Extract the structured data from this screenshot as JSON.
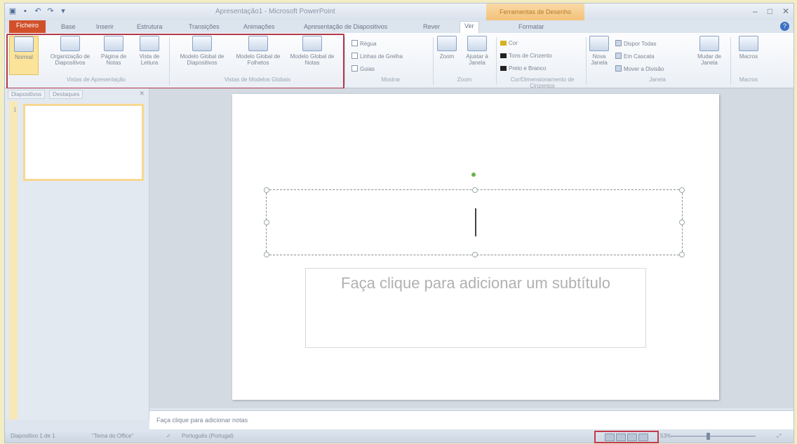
{
  "window": {
    "title": "Apresentação1 - Microsoft PowerPoint",
    "context_tab_title": "Ferramentas de Desenho"
  },
  "tabs": [
    {
      "label": "Ficheiro"
    },
    {
      "label": "Base"
    },
    {
      "label": "Inserir"
    },
    {
      "label": "Estrutura"
    },
    {
      "label": "Transições"
    },
    {
      "label": "Animações"
    },
    {
      "label": "Apresentação de Diapositivos"
    },
    {
      "label": "Rever"
    },
    {
      "label": "Ver"
    },
    {
      "label": "Formatar"
    }
  ],
  "ribbon": {
    "presentation_views": {
      "label": "Vistas de Apresentação",
      "buttons": [
        "Normal",
        "Organização de Diapositivos",
        "Página de Notas",
        "Vista de Leitura"
      ]
    },
    "master_views": {
      "label": "Vistas de Modelos Globais",
      "buttons": [
        "Modelo Global de Diapositivos",
        "Modelo Global de Folhetos",
        "Modelo Global de Notas"
      ]
    },
    "show": {
      "label": "Mostrar",
      "items": [
        "Régua",
        "Linhas de Grelha",
        "Guias"
      ]
    },
    "zoom": {
      "label": "Zoom",
      "buttons": [
        "Zoom",
        "Ajustar à Janela"
      ]
    },
    "color": {
      "label": "Cor/Dimensionamento de Cinzentos",
      "items": [
        "Cor",
        "Tons de Cinzento",
        "Preto e Branco"
      ]
    },
    "window": {
      "label": "Janela",
      "new_window": "Nova Janela",
      "items": [
        "Dispor Todas",
        "Em Cascata",
        "Mover a Divisão"
      ],
      "switch": "Mudar de Janela"
    },
    "macros": {
      "label": "Macros",
      "button": "Macros"
    }
  },
  "left_pane": {
    "tabs": [
      "Diapositivos",
      "Destaques"
    ],
    "slide_number": "1"
  },
  "slide": {
    "subtitle_placeholder": "Faça clique para adicionar um subtítulo"
  },
  "notes": {
    "placeholder": "Faça clique para adicionar notas"
  },
  "status": {
    "slide_info": "Diapositivo 1 de 1",
    "theme": "\"Tema do Office\"",
    "language": "Português (Portugal)",
    "zoom": "53%"
  }
}
